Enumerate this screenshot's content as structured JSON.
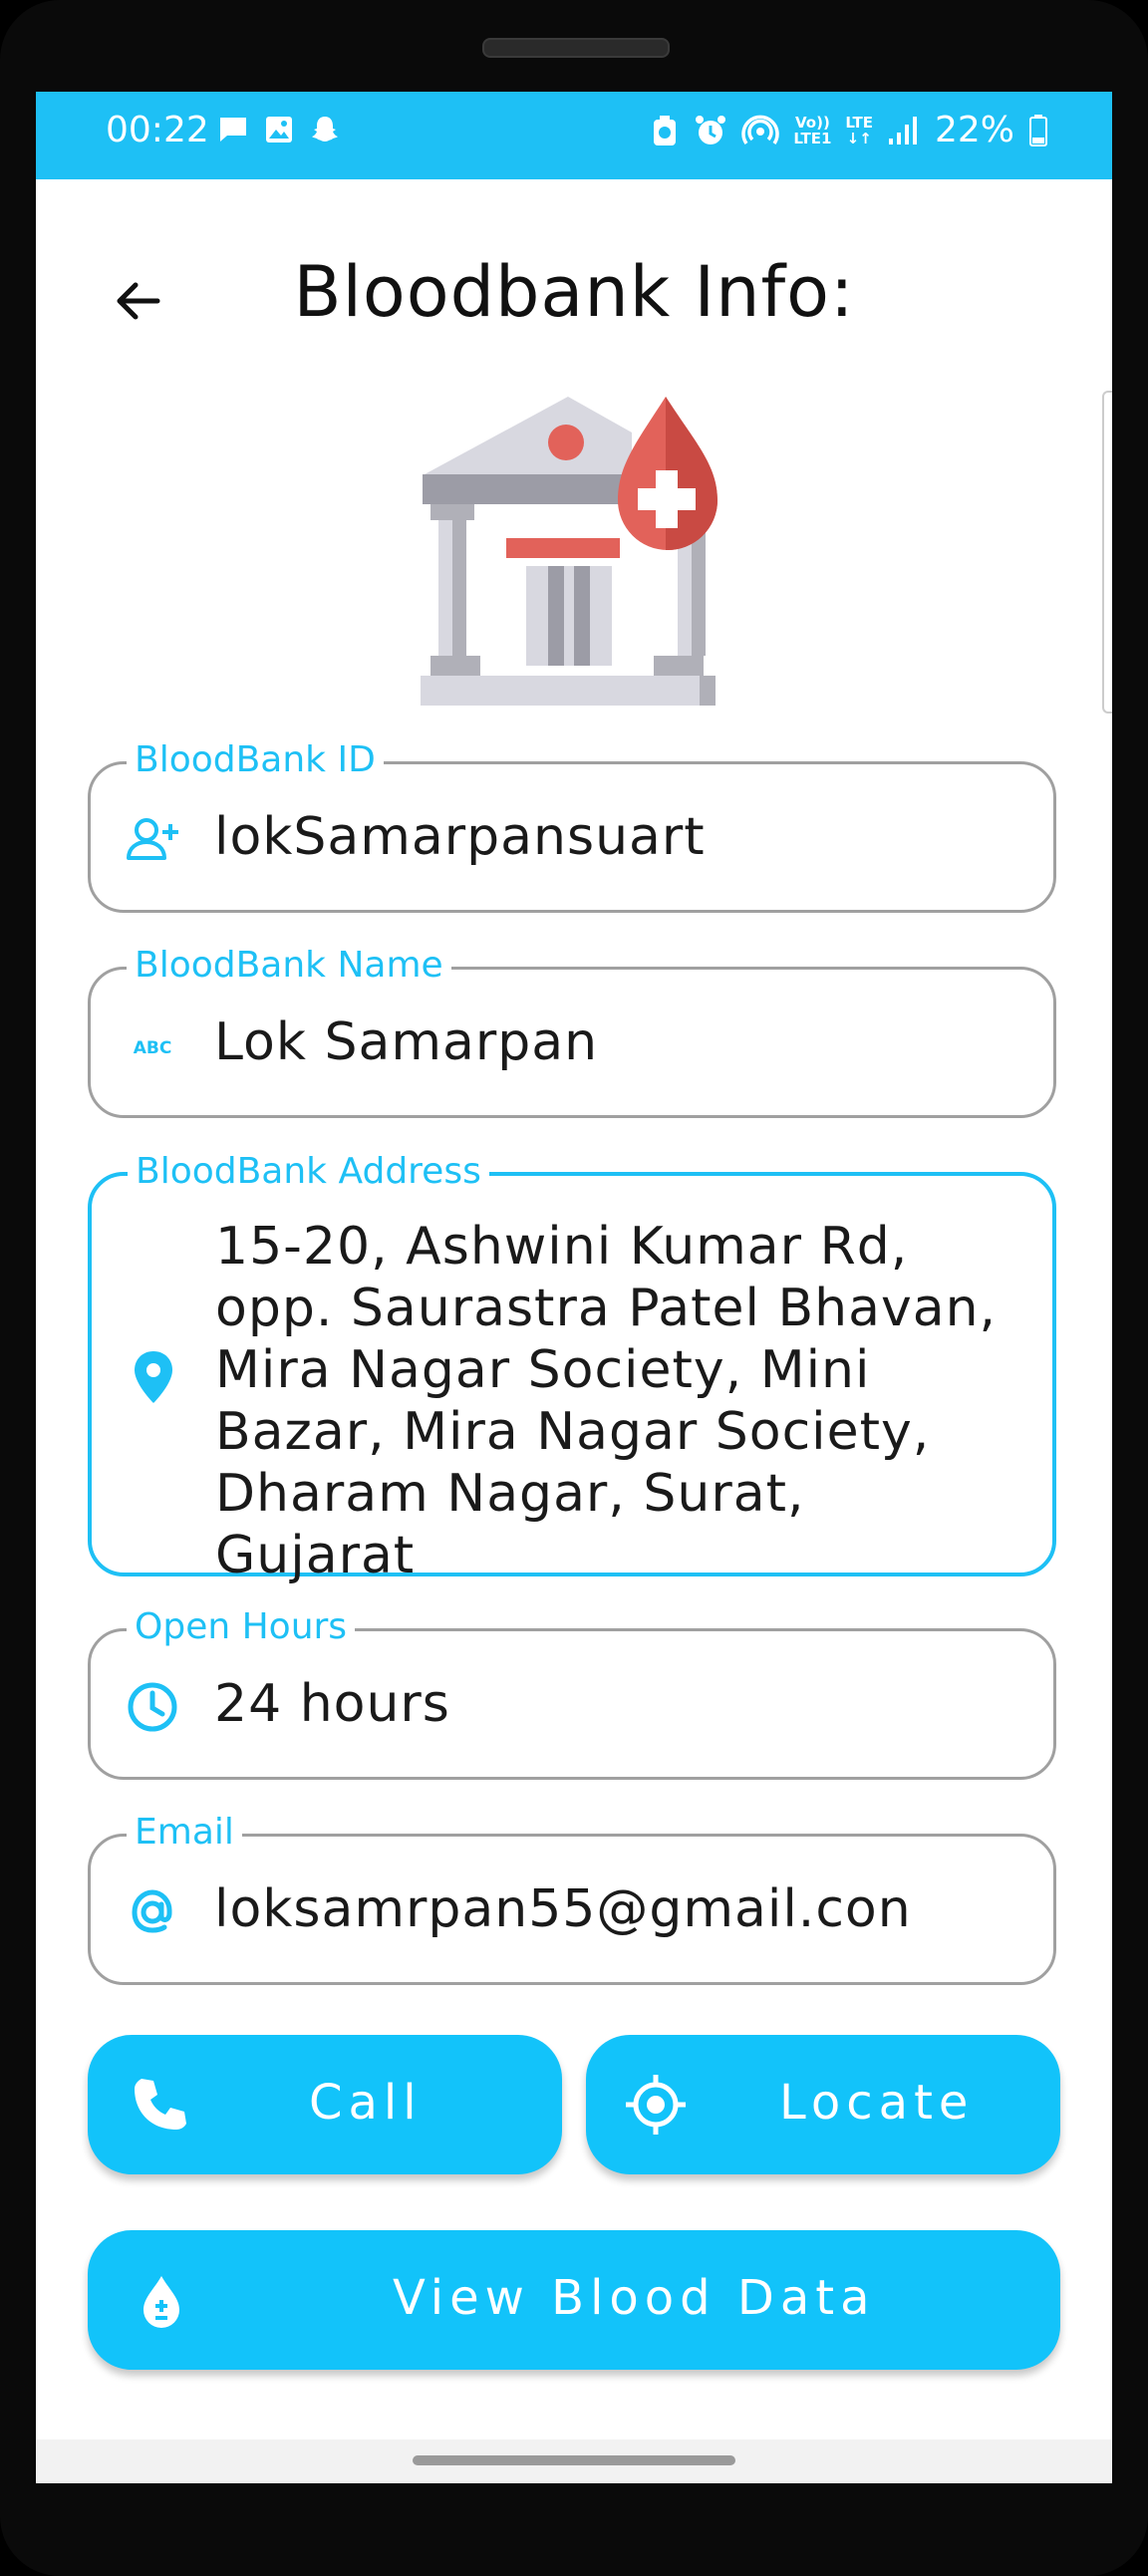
{
  "status_bar": {
    "time": "00:22",
    "battery": "22%",
    "volte_label": "Vo))\nLTE1",
    "lte_label": "LTE",
    "left_icons": [
      "message-icon",
      "image-icon",
      "snapchat-icon"
    ],
    "right_icons": [
      "recycle-icon",
      "alarm-icon",
      "hotspot-icon",
      "volte-icon",
      "lte-icon",
      "signal-icon",
      "battery-icon"
    ]
  },
  "header": {
    "title": "Bloodbank Info:"
  },
  "fields": {
    "id": {
      "label": "BloodBank ID",
      "value": "lokSamarpansuart",
      "icon": "add-user-icon"
    },
    "name": {
      "label": "BloodBank Name",
      "value": "Lok Samarpan",
      "icon": "abc-icon",
      "icon_text": "ABC"
    },
    "address": {
      "label": "BloodBank Address",
      "value": "15-20, Ashwini Kumar Rd, opp. Saurastra Patel Bhavan, Mira Nagar Society, Mini Bazar, Mira Nagar Society, Dharam Nagar, Surat, Gujarat",
      "icon": "location-pin-icon"
    },
    "hours": {
      "label": "Open Hours",
      "value": "24 hours",
      "icon": "clock-icon"
    },
    "email": {
      "label": "Email",
      "value": "loksamrpan55@gmail.con",
      "icon": "at-icon"
    }
  },
  "buttons": {
    "call": "Call",
    "locate": "Locate",
    "view_blood": "View Blood Data"
  },
  "colors": {
    "accent": "#1ec0f5",
    "button": "#12c3fa",
    "border": "#a0a0a0"
  }
}
